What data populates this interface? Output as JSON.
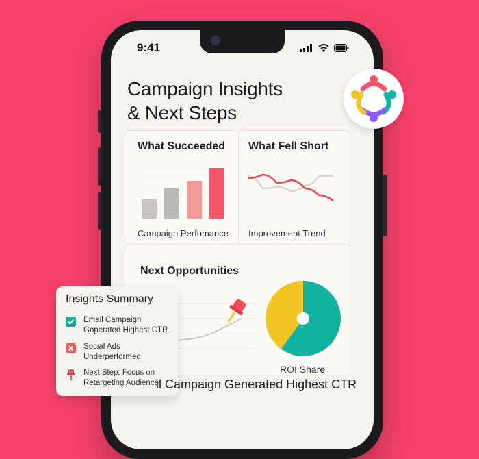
{
  "status_bar": {
    "time": "9:41"
  },
  "page": {
    "title_line1": "Campaign Insights",
    "title_line2": "& Next Steps"
  },
  "cards": {
    "succeeded": {
      "heading": "What Succeeded",
      "caption": "Campaign Perfomance"
    },
    "fell_short": {
      "heading": "What Fell Short",
      "caption": "Improvement Trend"
    },
    "opportunities": {
      "heading": "Next Opportunities"
    },
    "roi": {
      "caption": "ROI Share"
    }
  },
  "chart_data": [
    {
      "type": "bar",
      "title": "What Succeeded",
      "caption": "Campaign Perfomance",
      "categories": [
        "",
        "",
        "",
        ""
      ],
      "values": [
        30,
        45,
        56,
        76
      ],
      "colors": [
        "#c9c6c2",
        "#bcbab6",
        "#f39a9a",
        "#f2556a"
      ]
    },
    {
      "type": "line",
      "title": "What Fell Short",
      "caption": "Improvement Trend",
      "series": [
        {
          "values": [
            55,
            60,
            48,
            52,
            40,
            30,
            22
          ],
          "color": "#e04a55"
        },
        {
          "values": [
            58,
            40,
            42,
            36,
            44,
            58,
            58
          ],
          "color": "#d9d5cf"
        }
      ]
    },
    {
      "type": "pie",
      "caption": "ROI Share",
      "slices": [
        {
          "value": 60,
          "color": "#12b3a2"
        },
        {
          "value": 40,
          "color": "#f2c525"
        }
      ]
    }
  ],
  "summary": {
    "title": "Insights Summary",
    "items": [
      {
        "text": "Email Campaign Goperated Highest CTR",
        "icon": "check-icon",
        "color": "#1aa89a"
      },
      {
        "text": "Social Ads Underperformed",
        "icon": "x-icon",
        "color": "#ef5a62"
      },
      {
        "text": "Next Step: Focus on Retargeting Audience",
        "icon": "pin-icon",
        "color": "#ef5a62"
      }
    ]
  },
  "footer_text": "il Campaign Generated Highest CTR",
  "colors": {
    "background": "#f5416a",
    "accent_red": "#f2556a",
    "teal": "#12b3a2",
    "yellow": "#f2c525"
  }
}
